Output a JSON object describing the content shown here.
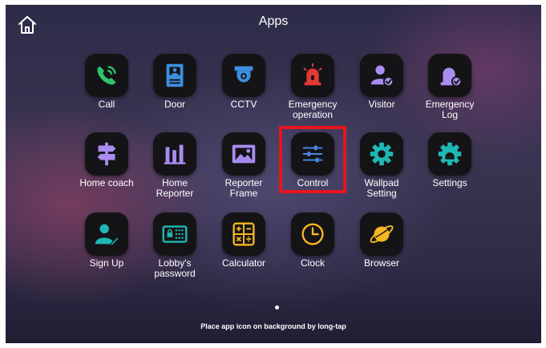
{
  "header": {
    "title": "Apps",
    "home_icon": "home-icon"
  },
  "apps": [
    {
      "label": "Call",
      "icon": "phone-icon",
      "color": "#2fc36b"
    },
    {
      "label": "Door",
      "icon": "door-icon",
      "color": "#3e8fe0"
    },
    {
      "label": "CCTV",
      "icon": "cctv-camera-icon",
      "color": "#3e8fe0"
    },
    {
      "label": "Emergency\noperation",
      "icon": "siren-icon",
      "color": "#e53935"
    },
    {
      "label": "Visitor",
      "icon": "visitor-icon",
      "color": "#a98cf0"
    },
    {
      "label": "Emergency\nLog",
      "icon": "emergency-log-icon",
      "color": "#a98cf0"
    },
    {
      "label": "Home coach",
      "icon": "signpost-icon",
      "color": "#a98cf0"
    },
    {
      "label": "Home\nReporter",
      "icon": "bar-chart-icon",
      "color": "#a98cf0"
    },
    {
      "label": "Reporter\nFrame",
      "icon": "picture-frame-icon",
      "color": "#a98cf0"
    },
    {
      "label": "Control",
      "icon": "sliders-icon",
      "color": "#4a86e8"
    },
    {
      "label": "Wallpad\nSetting",
      "icon": "gear-icon",
      "color": "#1fb8b5"
    },
    {
      "label": "Settings",
      "icon": "android-gear-icon",
      "color": "#1fb8b5"
    },
    {
      "label": "Sign Up",
      "icon": "sign-up-icon",
      "color": "#1fb8b5"
    },
    {
      "label": "Lobby's\npassword",
      "icon": "keypad-lock-icon",
      "color": "#1fb8b5"
    },
    {
      "label": "Calculator",
      "icon": "calculator-icon",
      "color": "#f5b623"
    },
    {
      "label": "Clock",
      "icon": "clock-icon",
      "color": "#f5b623"
    },
    {
      "label": "Browser",
      "icon": "planet-icon",
      "color": "#f5b623"
    }
  ],
  "highlighted_app": "Control",
  "highlight_color": "#e8141c",
  "footer": {
    "hint": "Place app icon on background by long-tap"
  }
}
